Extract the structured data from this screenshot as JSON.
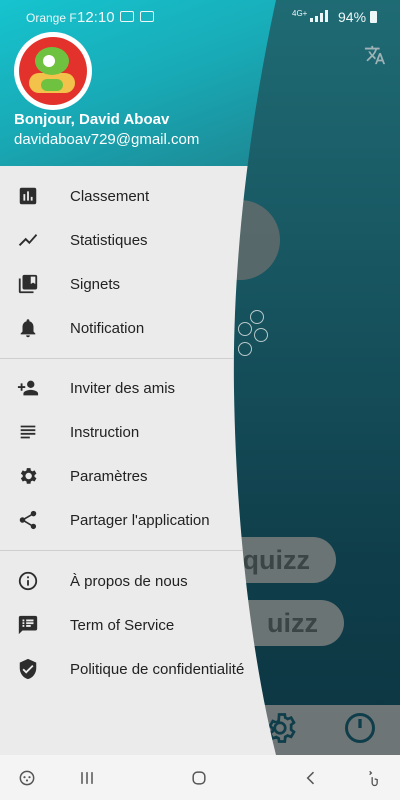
{
  "status_bar": {
    "carrier": "Orange F",
    "time": "12:10",
    "network": "4G+",
    "battery": "94%"
  },
  "drawer": {
    "greeting": "Bonjour, David Aboav",
    "email": "davidaboav729@gmail.com",
    "section1": [
      {
        "label": "Classement",
        "icon": "leaderboard-icon"
      },
      {
        "label": "Statistiques",
        "icon": "trending-line-icon"
      },
      {
        "label": "Signets",
        "icon": "bookmarks-icon"
      },
      {
        "label": "Notification",
        "icon": "bell-icon"
      }
    ],
    "section2": [
      {
        "label": "Inviter des amis",
        "icon": "person-add-icon"
      },
      {
        "label": "Instruction",
        "icon": "notes-icon"
      },
      {
        "label": "Paramètres",
        "icon": "gear-icon"
      },
      {
        "label": "Partager l'application",
        "icon": "share-icon"
      }
    ],
    "section3": [
      {
        "label": "À propos de nous",
        "icon": "info-icon"
      },
      {
        "label": "Term of Service",
        "icon": "chat-list-icon"
      },
      {
        "label": "Politique de confidentialité",
        "icon": "shield-check-icon"
      }
    ]
  },
  "background": {
    "button1_label": "quizz",
    "button2_label": "uizz"
  },
  "colors": {
    "header_start": "#16c4cf",
    "header_end": "#1f7c87",
    "drawer_bg": "#ebebeb",
    "background_app": "#175560"
  }
}
